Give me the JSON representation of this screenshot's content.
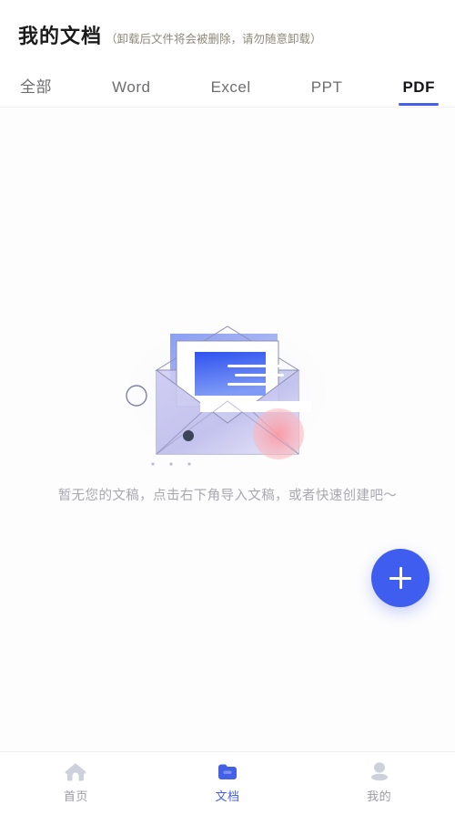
{
  "header": {
    "title": "我的文档",
    "note": "（卸载后文件将会被删除，请勿随意卸载）"
  },
  "tabs": {
    "items": [
      {
        "label": "全部",
        "active": false
      },
      {
        "label": "Word",
        "active": false
      },
      {
        "label": "Excel",
        "active": false
      },
      {
        "label": "PPT",
        "active": false
      },
      {
        "label": "PDF",
        "active": true
      }
    ],
    "active_label": "PDF",
    "indicator_color": "#4460e6"
  },
  "empty_state": {
    "illustration": "empty-envelope-document-illustration",
    "message": "暂无您的文稿，点击右下角导入文稿，或者快速创建吧～",
    "text_color": "#a8a8b0"
  },
  "fab": {
    "icon": "plus-icon",
    "label": "+",
    "color": "#3f5ef0"
  },
  "bottom_nav": {
    "items": [
      {
        "label": "首页",
        "icon": "home-icon",
        "active": false
      },
      {
        "label": "文档",
        "icon": "folder-icon",
        "active": true
      },
      {
        "label": "我的",
        "icon": "person-icon",
        "active": false
      }
    ],
    "active_color": "#4460e6",
    "inactive_color": "#c9cdd7"
  },
  "colors": {
    "background": "#ffffff",
    "accent": "#4460e6",
    "title": "#1b1b1b",
    "note": "#8e897b",
    "tab_inactive": "#6d6d72",
    "illustration_blue": "#4a63e8",
    "illustration_purple": "#b8b4e8",
    "illustration_pink": "#f9a3ab"
  }
}
